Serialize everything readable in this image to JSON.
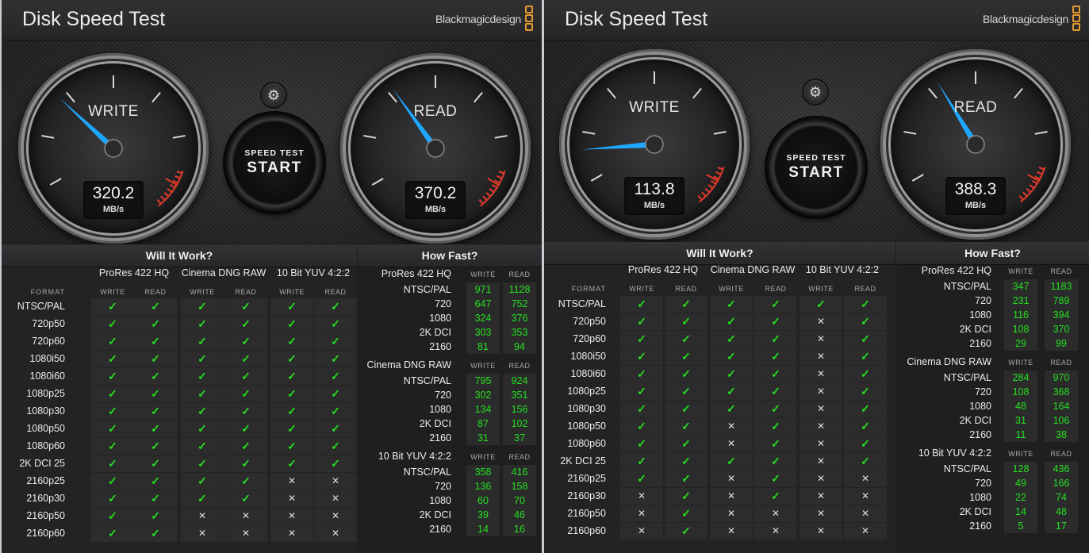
{
  "windows": [
    {
      "title": "Disk Speed Test",
      "brand": "Blackmagicdesign",
      "write_gauge": {
        "label": "WRITE",
        "value": "320.2",
        "unit": "MB/s"
      },
      "read_gauge": {
        "label": "READ",
        "value": "370.2",
        "unit": "MB/s"
      },
      "start_button": {
        "line1": "SPEED TEST",
        "line2": "START"
      },
      "will_it_work": {
        "title": "Will It Work?",
        "format_header": "FORMAT",
        "codecs": [
          "ProRes 422 HQ",
          "Cinema DNG RAW",
          "10 Bit YUV 4:2:2"
        ],
        "subheaders": [
          "WRITE",
          "READ"
        ],
        "rows": [
          {
            "format": "NTSC/PAL",
            "cells": [
              1,
              1,
              1,
              1,
              1,
              1
            ]
          },
          {
            "format": "720p50",
            "cells": [
              1,
              1,
              1,
              1,
              1,
              1
            ]
          },
          {
            "format": "720p60",
            "cells": [
              1,
              1,
              1,
              1,
              1,
              1
            ]
          },
          {
            "format": "1080i50",
            "cells": [
              1,
              1,
              1,
              1,
              1,
              1
            ]
          },
          {
            "format": "1080i60",
            "cells": [
              1,
              1,
              1,
              1,
              1,
              1
            ]
          },
          {
            "format": "1080p25",
            "cells": [
              1,
              1,
              1,
              1,
              1,
              1
            ]
          },
          {
            "format": "1080p30",
            "cells": [
              1,
              1,
              1,
              1,
              1,
              1
            ]
          },
          {
            "format": "1080p50",
            "cells": [
              1,
              1,
              1,
              1,
              1,
              1
            ]
          },
          {
            "format": "1080p60",
            "cells": [
              1,
              1,
              1,
              1,
              1,
              1
            ]
          },
          {
            "format": "2K DCI 25",
            "cells": [
              1,
              1,
              1,
              1,
              1,
              1
            ]
          },
          {
            "format": "2160p25",
            "cells": [
              1,
              1,
              1,
              1,
              0,
              0
            ]
          },
          {
            "format": "2160p30",
            "cells": [
              1,
              1,
              1,
              1,
              0,
              0
            ]
          },
          {
            "format": "2160p50",
            "cells": [
              1,
              1,
              0,
              0,
              0,
              0
            ]
          },
          {
            "format": "2160p60",
            "cells": [
              1,
              1,
              0,
              0,
              0,
              0
            ]
          }
        ]
      },
      "how_fast": {
        "title": "How Fast?",
        "subheaders": [
          "WRITE",
          "READ"
        ],
        "groups": [
          {
            "codec": "ProRes 422 HQ",
            "rows": [
              {
                "label": "NTSC/PAL",
                "write": "971",
                "read": "1128"
              },
              {
                "label": "720",
                "write": "647",
                "read": "752"
              },
              {
                "label": "1080",
                "write": "324",
                "read": "376"
              },
              {
                "label": "2K DCI",
                "write": "303",
                "read": "353"
              },
              {
                "label": "2160",
                "write": "81",
                "read": "94"
              }
            ]
          },
          {
            "codec": "Cinema DNG RAW",
            "rows": [
              {
                "label": "NTSC/PAL",
                "write": "795",
                "read": "924"
              },
              {
                "label": "720",
                "write": "302",
                "read": "351"
              },
              {
                "label": "1080",
                "write": "134",
                "read": "156"
              },
              {
                "label": "2K DCI",
                "write": "87",
                "read": "102"
              },
              {
                "label": "2160",
                "write": "31",
                "read": "37"
              }
            ]
          },
          {
            "codec": "10 Bit YUV 4:2:2",
            "rows": [
              {
                "label": "NTSC/PAL",
                "write": "358",
                "read": "416"
              },
              {
                "label": "720",
                "write": "136",
                "read": "158"
              },
              {
                "label": "1080",
                "write": "60",
                "read": "70"
              },
              {
                "label": "2K DCI",
                "write": "39",
                "read": "46"
              },
              {
                "label": "2160",
                "write": "14",
                "read": "16"
              }
            ]
          }
        ]
      }
    },
    {
      "title": "Disk Speed Test",
      "brand": "Blackmagicdesign",
      "write_gauge": {
        "label": "WRITE",
        "value": "113.8",
        "unit": "MB/s"
      },
      "read_gauge": {
        "label": "READ",
        "value": "388.3",
        "unit": "MB/s"
      },
      "start_button": {
        "line1": "SPEED TEST",
        "line2": "START"
      },
      "will_it_work": {
        "title": "Will It Work?",
        "format_header": "FORMAT",
        "codecs": [
          "ProRes 422 HQ",
          "Cinema DNG RAW",
          "10 Bit YUV 4:2:2"
        ],
        "subheaders": [
          "WRITE",
          "READ"
        ],
        "rows": [
          {
            "format": "NTSC/PAL",
            "cells": [
              1,
              1,
              1,
              1,
              1,
              1
            ]
          },
          {
            "format": "720p50",
            "cells": [
              1,
              1,
              1,
              1,
              0,
              1
            ]
          },
          {
            "format": "720p60",
            "cells": [
              1,
              1,
              1,
              1,
              0,
              1
            ]
          },
          {
            "format": "1080i50",
            "cells": [
              1,
              1,
              1,
              1,
              0,
              1
            ]
          },
          {
            "format": "1080i60",
            "cells": [
              1,
              1,
              1,
              1,
              0,
              1
            ]
          },
          {
            "format": "1080p25",
            "cells": [
              1,
              1,
              1,
              1,
              0,
              1
            ]
          },
          {
            "format": "1080p30",
            "cells": [
              1,
              1,
              1,
              1,
              0,
              1
            ]
          },
          {
            "format": "1080p50",
            "cells": [
              1,
              1,
              0,
              1,
              0,
              1
            ]
          },
          {
            "format": "1080p60",
            "cells": [
              1,
              1,
              0,
              1,
              0,
              1
            ]
          },
          {
            "format": "2K DCI 25",
            "cells": [
              1,
              1,
              1,
              1,
              0,
              1
            ]
          },
          {
            "format": "2160p25",
            "cells": [
              1,
              1,
              0,
              1,
              0,
              0
            ]
          },
          {
            "format": "2160p30",
            "cells": [
              0,
              1,
              0,
              1,
              0,
              0
            ]
          },
          {
            "format": "2160p50",
            "cells": [
              0,
              1,
              0,
              0,
              0,
              0
            ]
          },
          {
            "format": "2160p60",
            "cells": [
              0,
              1,
              0,
              0,
              0,
              0
            ]
          }
        ]
      },
      "how_fast": {
        "title": "How Fast?",
        "subheaders": [
          "WRITE",
          "READ"
        ],
        "groups": [
          {
            "codec": "ProRes 422 HQ",
            "rows": [
              {
                "label": "NTSC/PAL",
                "write": "347",
                "read": "1183"
              },
              {
                "label": "720",
                "write": "231",
                "read": "789"
              },
              {
                "label": "1080",
                "write": "116",
                "read": "394"
              },
              {
                "label": "2K DCI",
                "write": "108",
                "read": "370"
              },
              {
                "label": "2160",
                "write": "29",
                "read": "99"
              }
            ]
          },
          {
            "codec": "Cinema DNG RAW",
            "rows": [
              {
                "label": "NTSC/PAL",
                "write": "284",
                "read": "970"
              },
              {
                "label": "720",
                "write": "108",
                "read": "368"
              },
              {
                "label": "1080",
                "write": "48",
                "read": "164"
              },
              {
                "label": "2K DCI",
                "write": "31",
                "read": "106"
              },
              {
                "label": "2160",
                "write": "11",
                "read": "38"
              }
            ]
          },
          {
            "codec": "10 Bit YUV 4:2:2",
            "rows": [
              {
                "label": "NTSC/PAL",
                "write": "128",
                "read": "436"
              },
              {
                "label": "720",
                "write": "49",
                "read": "166"
              },
              {
                "label": "1080",
                "write": "22",
                "read": "74"
              },
              {
                "label": "2K DCI",
                "write": "14",
                "read": "48"
              },
              {
                "label": "2160",
                "write": "5",
                "read": "17"
              }
            ]
          }
        ]
      }
    }
  ],
  "icons": {
    "gear": "gear-icon",
    "check": "check-icon",
    "cross": "cross-icon"
  },
  "colors": {
    "check": "#25e01f",
    "gauge_needle": "#1ea7ff",
    "redline": "#e23b2b",
    "brand_logo": "#e59a2f"
  }
}
